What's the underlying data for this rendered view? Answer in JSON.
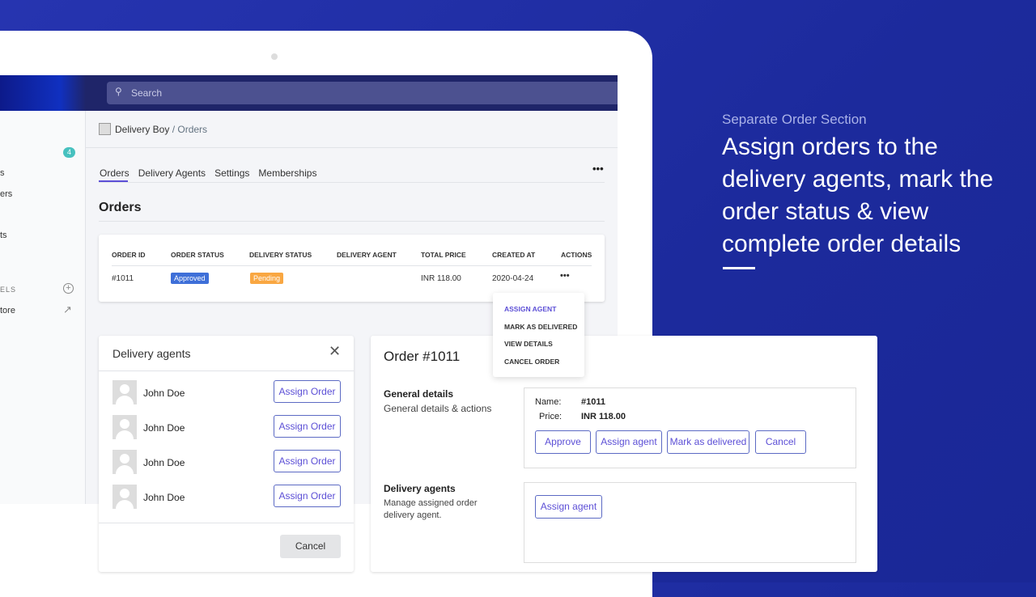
{
  "hero": {
    "subtitle": "Separate Order Section",
    "title": "Assign orders to the delivery agents, mark the order status & view complete order details"
  },
  "search": {
    "placeholder": "Search"
  },
  "sidebar": {
    "badge": "4",
    "items": [
      "s",
      "ers",
      "ts"
    ],
    "section": "ELS",
    "store": "tore"
  },
  "breadcrumb": {
    "app": "Delivery Boy",
    "page": "/ Orders"
  },
  "tabs": [
    "Orders",
    "Delivery Agents",
    "Settings",
    "Memberships"
  ],
  "page_title": "Orders",
  "table": {
    "headers": [
      "ORDER ID",
      "ORDER STATUS",
      "DELIVERY STATUS",
      "DELIVERY AGENT",
      "TOTAL PRICE",
      "CREATED AT",
      "ACTIONS"
    ],
    "row": {
      "id": "#1011",
      "order_status": "Approved",
      "delivery_status": "Pending",
      "agent": "",
      "price": "INR 118.00",
      "created": "2020-04-24",
      "actions": "•••"
    }
  },
  "menu": [
    "ASSIGN AGENT",
    "MARK AS DELIVERED",
    "VIEW DETAILS",
    "CANCEL ORDER"
  ],
  "agents_modal": {
    "title": "Delivery agents",
    "agents": [
      "John Doe",
      "John Doe",
      "John Doe",
      "John Doe"
    ],
    "assign_label": "Assign Order",
    "cancel": "Cancel"
  },
  "order_panel": {
    "title": "Order #1011",
    "general_title": "General details",
    "general_desc": "General details & actions",
    "name_label": "Name:",
    "name_value": "#1011",
    "price_label": "Price:",
    "price_value": "INR 118.00",
    "buttons": [
      "Approve",
      "Assign agent",
      "Mark as delivered",
      "Cancel"
    ],
    "agents_title": "Delivery agents",
    "agents_desc": "Manage assigned order delivery agent.",
    "assign_agent": "Assign agent"
  },
  "colors": {
    "accent": "#5c4fd6",
    "approved": "#3e6fd8",
    "pending": "#f9a742",
    "badge": "#47c1bf",
    "background": "#1f2ca0"
  }
}
